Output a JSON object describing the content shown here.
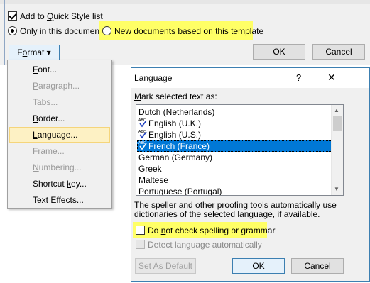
{
  "style_dialog": {
    "add_quick_style": {
      "label_pre": "Add to ",
      "label_u": "Q",
      "label_post": "uick Style list",
      "checked": true
    },
    "only_doc": {
      "label_pre": "Only in this ",
      "label_u": "d",
      "label_post": "ocument"
    },
    "new_docs": {
      "label_pre": "New documents based on this template"
    },
    "format_button": {
      "label_pre": "F",
      "label_u": "o",
      "label_post": "rmat",
      "arrow": "▾"
    },
    "ok_label": "OK",
    "cancel_label": "Cancel"
  },
  "format_menu": {
    "items": [
      {
        "pre": "",
        "u": "F",
        "post": "ont..."
      },
      {
        "pre": "",
        "u": "P",
        "post": "aragraph..."
      },
      {
        "pre": "",
        "u": "T",
        "post": "abs..."
      },
      {
        "pre": "",
        "u": "B",
        "post": "order..."
      },
      {
        "pre": "",
        "u": "L",
        "post": "anguage..."
      },
      {
        "pre": "Fra",
        "u": "m",
        "post": "e..."
      },
      {
        "pre": "",
        "u": "N",
        "post": "umbering..."
      },
      {
        "pre": "Shortcut ",
        "u": "k",
        "post": "ey..."
      },
      {
        "pre": "Text ",
        "u": "E",
        "post": "ffects..."
      }
    ]
  },
  "language_dialog": {
    "title": "Language",
    "help": "?",
    "close": "✕",
    "mark_label": {
      "u": "M",
      "post": "ark selected text as:"
    },
    "languages": [
      "Dutch (Netherlands)",
      "English (U.K.)",
      "English (U.S.)",
      "French (France)",
      "German (Germany)",
      "Greek",
      "Maltese",
      "Portuguese (Portugal)"
    ],
    "spell_icon_text": "ABC",
    "description_line1": "The speller and other proofing tools automatically use",
    "description_line2": "dictionaries of the selected language, if available.",
    "no_check": {
      "pre": "Do ",
      "u": "n",
      "post": "ot check spelling or grammar"
    },
    "detect": {
      "label": "Detect language automatically"
    },
    "set_default_label": "Set As Default",
    "ok_label": "OK",
    "cancel_label": "Cancel",
    "scroll_up": "▲",
    "scroll_down": "▼"
  },
  "colors": {
    "highlight": "#ffff66",
    "selection": "#0078d7",
    "menu_hover": "#fdf1c4"
  }
}
